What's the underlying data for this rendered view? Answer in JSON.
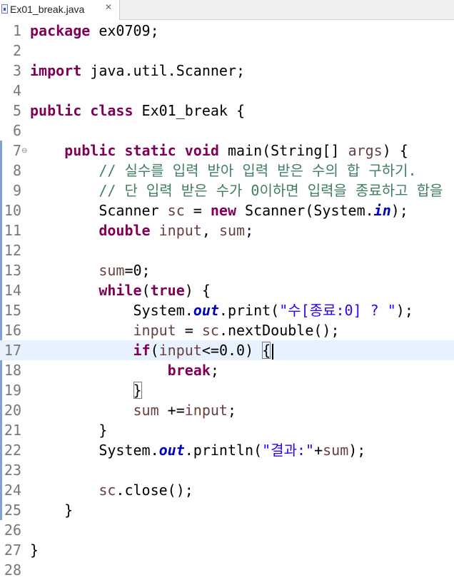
{
  "tab": {
    "filename": "Ex01_break.java",
    "close_glyph": "✕"
  },
  "editor": {
    "current_line": 17,
    "lines": [
      {
        "n": "1",
        "tokens": [
          {
            "t": "package",
            "c": "kw"
          },
          {
            "t": " ex0709;",
            "c": ""
          }
        ]
      },
      {
        "n": "2",
        "tokens": []
      },
      {
        "n": "3",
        "tokens": [
          {
            "t": "import",
            "c": "kw"
          },
          {
            "t": " java.util.Scanner;",
            "c": ""
          }
        ]
      },
      {
        "n": "4",
        "tokens": []
      },
      {
        "n": "5",
        "tokens": [
          {
            "t": "public",
            "c": "kw"
          },
          {
            "t": " ",
            "c": ""
          },
          {
            "t": "class",
            "c": "kw"
          },
          {
            "t": " Ex01_break {",
            "c": ""
          }
        ]
      },
      {
        "n": "6",
        "tokens": []
      },
      {
        "n": "7",
        "fold": true,
        "tokens": [
          {
            "t": "    ",
            "c": ""
          },
          {
            "t": "public",
            "c": "kw"
          },
          {
            "t": " ",
            "c": ""
          },
          {
            "t": "static",
            "c": "kw"
          },
          {
            "t": " ",
            "c": ""
          },
          {
            "t": "void",
            "c": "kw"
          },
          {
            "t": " main(String[] ",
            "c": ""
          },
          {
            "t": "args",
            "c": "var"
          },
          {
            "t": ") {",
            "c": ""
          }
        ]
      },
      {
        "n": "8",
        "tokens": [
          {
            "t": "        ",
            "c": ""
          },
          {
            "t": "// 실수를 입력 받아 입력 받은 수의 합 구하기.",
            "c": "cm"
          }
        ]
      },
      {
        "n": "9",
        "tokens": [
          {
            "t": "        ",
            "c": ""
          },
          {
            "t": "// 단 입력 받은 수가 0이하면 입력을 종료하고 합을",
            "c": "cm"
          }
        ]
      },
      {
        "n": "10",
        "tokens": [
          {
            "t": "        Scanner ",
            "c": ""
          },
          {
            "t": "sc",
            "c": "var"
          },
          {
            "t": " = ",
            "c": ""
          },
          {
            "t": "new",
            "c": "kw"
          },
          {
            "t": " Scanner(System.",
            "c": ""
          },
          {
            "t": "in",
            "c": "fld"
          },
          {
            "t": ");",
            "c": ""
          }
        ]
      },
      {
        "n": "11",
        "tokens": [
          {
            "t": "        ",
            "c": ""
          },
          {
            "t": "double",
            "c": "kw"
          },
          {
            "t": " ",
            "c": ""
          },
          {
            "t": "input",
            "c": "var"
          },
          {
            "t": ", ",
            "c": ""
          },
          {
            "t": "sum",
            "c": "var"
          },
          {
            "t": ";",
            "c": ""
          }
        ]
      },
      {
        "n": "12",
        "tokens": []
      },
      {
        "n": "13",
        "tokens": [
          {
            "t": "        ",
            "c": ""
          },
          {
            "t": "sum",
            "c": "var"
          },
          {
            "t": "=0;",
            "c": ""
          }
        ]
      },
      {
        "n": "14",
        "tokens": [
          {
            "t": "        ",
            "c": ""
          },
          {
            "t": "while",
            "c": "kw"
          },
          {
            "t": "(",
            "c": ""
          },
          {
            "t": "true",
            "c": "kw"
          },
          {
            "t": ") {",
            "c": ""
          }
        ]
      },
      {
        "n": "15",
        "tokens": [
          {
            "t": "            System.",
            "c": ""
          },
          {
            "t": "out",
            "c": "fld"
          },
          {
            "t": ".print(",
            "c": ""
          },
          {
            "t": "\"수[종료:0] ? \"",
            "c": "str"
          },
          {
            "t": ");",
            "c": ""
          }
        ]
      },
      {
        "n": "16",
        "tokens": [
          {
            "t": "            ",
            "c": ""
          },
          {
            "t": "input",
            "c": "var"
          },
          {
            "t": " = ",
            "c": ""
          },
          {
            "t": "sc",
            "c": "var"
          },
          {
            "t": ".nextDouble();",
            "c": ""
          }
        ]
      },
      {
        "n": "17",
        "caret": true,
        "tokens": [
          {
            "t": "            ",
            "c": ""
          },
          {
            "t": "if",
            "c": "kw"
          },
          {
            "t": "(",
            "c": ""
          },
          {
            "t": "input",
            "c": "var"
          },
          {
            "t": "<=0.0) ",
            "c": ""
          },
          {
            "t": "{",
            "c": "bracket"
          }
        ]
      },
      {
        "n": "18",
        "tokens": [
          {
            "t": "                ",
            "c": ""
          },
          {
            "t": "break",
            "c": "kw"
          },
          {
            "t": ";",
            "c": ""
          }
        ]
      },
      {
        "n": "19",
        "tokens": [
          {
            "t": "            ",
            "c": ""
          },
          {
            "t": "}",
            "c": "bracket"
          }
        ]
      },
      {
        "n": "20",
        "tokens": [
          {
            "t": "            ",
            "c": ""
          },
          {
            "t": "sum",
            "c": "var"
          },
          {
            "t": " +=",
            "c": ""
          },
          {
            "t": "input",
            "c": "var"
          },
          {
            "t": ";",
            "c": ""
          }
        ]
      },
      {
        "n": "21",
        "tokens": [
          {
            "t": "        }",
            "c": ""
          }
        ]
      },
      {
        "n": "22",
        "tokens": [
          {
            "t": "        System.",
            "c": ""
          },
          {
            "t": "out",
            "c": "fld"
          },
          {
            "t": ".println(",
            "c": ""
          },
          {
            "t": "\"결과:\"",
            "c": "str"
          },
          {
            "t": "+",
            "c": ""
          },
          {
            "t": "sum",
            "c": "var"
          },
          {
            "t": ");",
            "c": ""
          }
        ]
      },
      {
        "n": "23",
        "tokens": []
      },
      {
        "n": "24",
        "tokens": [
          {
            "t": "        ",
            "c": ""
          },
          {
            "t": "sc",
            "c": "var"
          },
          {
            "t": ".close();",
            "c": ""
          }
        ]
      },
      {
        "n": "25",
        "tokens": [
          {
            "t": "    }",
            "c": ""
          }
        ]
      },
      {
        "n": "26",
        "tokens": []
      },
      {
        "n": "27",
        "tokens": [
          {
            "t": "}",
            "c": ""
          }
        ]
      },
      {
        "n": "28",
        "tokens": []
      }
    ]
  }
}
